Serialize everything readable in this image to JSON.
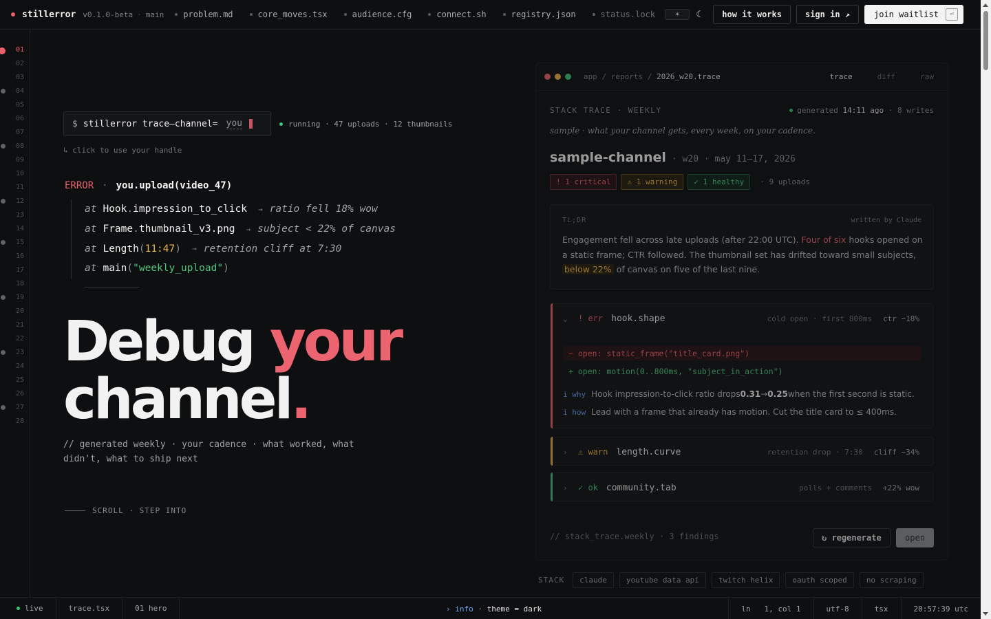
{
  "topbar": {
    "brand": "stillerror",
    "version": "v0.1.0-beta",
    "sep": "·",
    "branch": "main",
    "tabs": [
      "problem.md",
      "core_moves.tsx",
      "audience.cfg",
      "connect.sh",
      "registry.json",
      "status.lock"
    ],
    "theme_sun": "☀",
    "theme_moon": "☾",
    "how_label": "how it works",
    "signin_label": "sign in ↗",
    "waitlist_label": "join waitlist",
    "waitlist_kbd": "⏎"
  },
  "gutter": {
    "lines": [
      "01",
      "02",
      "03",
      "04",
      "05",
      "06",
      "07",
      "08",
      "09",
      "10",
      "11",
      "12",
      "13",
      "14",
      "15",
      "16",
      "17",
      "18",
      "19",
      "20",
      "21",
      "22",
      "23",
      "24",
      "25",
      "26",
      "27",
      "28"
    ],
    "active_line": "01"
  },
  "hero": {
    "prompt": "$",
    "command": "stillerror trace—channel=",
    "handle": "you",
    "running": "running · 47 uploads · 12 thumbnails",
    "hint": "↳ click to use your handle",
    "error_kw": "ERROR",
    "error_dot": "·",
    "error_call": "you.upload(video_47)",
    "trace": {
      "at": "at",
      "l1_obj": "Hook",
      "l1_dot": ".",
      "l1_meth": "impression_to_click",
      "l1_arrow": "→",
      "l1_note": "ratio fell 18% wow",
      "l2_obj": "Frame",
      "l2_dot": ".",
      "l2_meth": "thumbnail_v3.png",
      "l2_arrow": "→",
      "l2_note": "subject < 22% of canvas",
      "l3_obj": "Length",
      "l3_open": "(",
      "l3_val": "11:47",
      "l3_close": ")",
      "l3_arrow": "→",
      "l3_note": "retention cliff at 7:30",
      "l4_obj": "main",
      "l4_open": "(",
      "l4_str": "\"weekly_upload\"",
      "l4_close": ")"
    },
    "headline_1": "Debug ",
    "headline_accent": "your",
    "headline_2": "channel",
    "headline_dot": ".",
    "subtitle": "// generated weekly · your cadence · what worked, what didn't, what to ship next",
    "scroll_label": "SCROLL · STEP INTO"
  },
  "panel": {
    "crumb_1": "app",
    "crumb_2": "reports",
    "crumb_sep": "/",
    "crumb_file": "2026_w20.trace",
    "tabs": [
      "trace",
      "diff",
      "raw"
    ],
    "kicker": "STACK TRACE · WEEKLY",
    "generated_pre": "generated",
    "generated_time": "14:11 ago",
    "generated_post": "· 8 writes",
    "description": "sample · what your channel gets, every week, on your cadence.",
    "channel": "sample-channel",
    "channel_meta": "· w20 · may 11–17, 2026",
    "badge_critical": "! 1 critical",
    "badge_warning": "⚠ 1 warning",
    "badge_healthy": "✓ 1 healthy",
    "badge_uploads": "· 9 uploads",
    "tldr_label": "TL;DR",
    "tldr_by": "written by Claude",
    "tldr_1": "Engagement fell across late uploads (after 22:00 UTC). ",
    "tldr_red": "Four of six",
    "tldr_2": " hooks opened on a static frame; CTR followed. The thumbnail set has drifted toward small subjects, ",
    "tldr_yel": "below 22%",
    "tldr_3": " of canvas on five of the last nine.",
    "card1_chev": "⌄",
    "card1_lvl": "! err",
    "card1_name": "hook.shape",
    "card1_meta": "cold open · first 800ms",
    "card1_stat": "ctr −18%",
    "diff_del": "− open: static_frame(\"title_card.png\")",
    "diff_add": "+ open: motion(0..800ms, \"subject_in_action\")",
    "why_key": "i why",
    "why_text_1": "Hook impression-to-click ratio drops ",
    "why_b1": "0.31",
    "why_arrow": " → ",
    "why_b2": "0.25",
    "why_text_2": " when the first second is static.",
    "how_key": "i how",
    "how_text": "Lead with a frame that already has motion. Cut the title card to ≤ 400ms.",
    "card2_chev": "›",
    "card2_lvl": "⚠ warn",
    "card2_name": "length.curve",
    "card2_meta": "retention drop · 7:30",
    "card2_stat": "cliff −34%",
    "card3_chev": "›",
    "card3_lvl": "✓ ok",
    "card3_name": "community.tab",
    "card3_meta": "polls + comments",
    "card3_stat": "+22% wow",
    "footer": "// stack_trace.weekly · 3 findings",
    "regenerate_label": "↻ regenerate",
    "open_label": "open"
  },
  "stack": {
    "label": "STACK",
    "chips": [
      "claude",
      "youtube data api",
      "twitch helix",
      "oauth scoped",
      "no scraping"
    ]
  },
  "status": {
    "live": "live",
    "file": "trace.tsx",
    "section": "01 hero",
    "info_arrow": "›",
    "info": "info",
    "sep": "·",
    "theme": "theme = dark",
    "ln_label": "ln",
    "position": "1, col 1",
    "encoding": "utf-8",
    "lang": "tsx",
    "clock": "20:57:39 utc"
  },
  "colors": {
    "accent": "#ec6470",
    "ok": "#3fc27a",
    "warn": "#e9b24a",
    "info": "#6aa0f0",
    "bg": "#0e0f11"
  }
}
